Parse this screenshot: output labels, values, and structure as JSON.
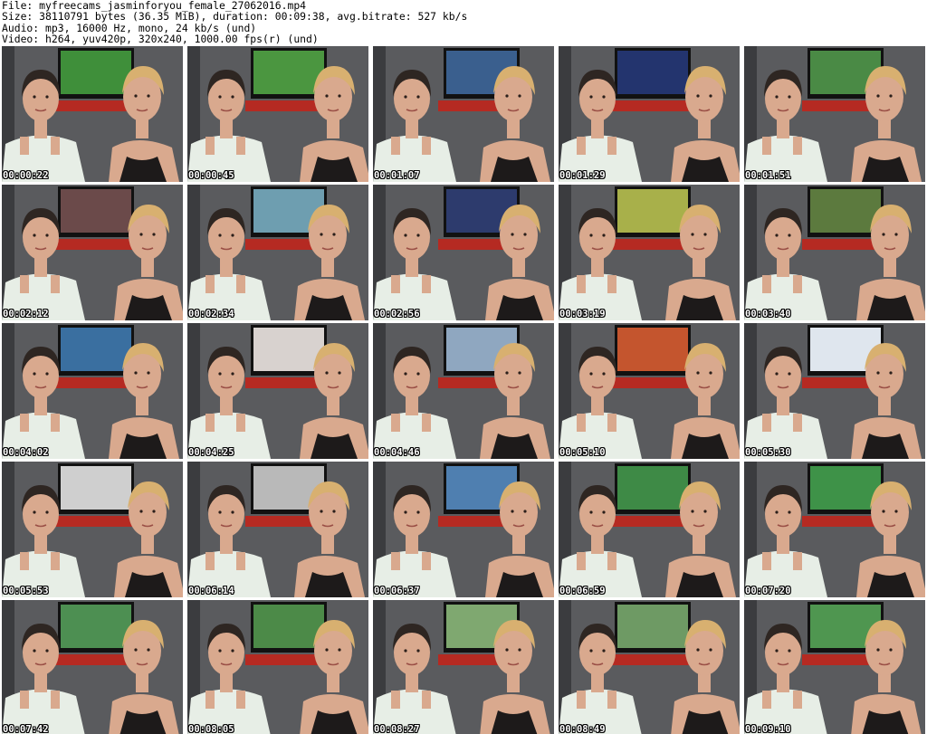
{
  "header": {
    "file_line": "File: myfreecams_jasminforyou_female_27062016.mp4",
    "size_line": "Size: 38110791 bytes (36.35 MiB), duration: 00:09:38, avg.bitrate: 527 kb/s",
    "audio_line": "Audio: mp3, 16000 Hz, mono, 24 kb/s (und)",
    "video_line": "Video: h264, yuv420p, 320x240, 1000.00 fps(r) (und)"
  },
  "colors": {
    "wall": "#5a5b5e",
    "skin": "#d9a98e",
    "blonde": "#d8b070",
    "dark_hair": "#2e2622",
    "white_top": "#e7eee6",
    "black_mesh": "#1d1a1a",
    "tv_frame": "#111111",
    "red_shelf": "#b52a22"
  },
  "thumbnails": [
    {
      "time": "00:00:22",
      "tv": "#3f8f3a"
    },
    {
      "time": "00:00:45",
      "tv": "#4b9640"
    },
    {
      "time": "00:01:07",
      "tv": "#3a5f8e"
    },
    {
      "time": "00:01:29",
      "tv": "#23346e"
    },
    {
      "time": "00:01:51",
      "tv": "#4a8a45"
    },
    {
      "time": "00:02:12",
      "tv": "#6b4a4a"
    },
    {
      "time": "00:02:34",
      "tv": "#6e9eb0"
    },
    {
      "time": "00:02:56",
      "tv": "#2d3b6d"
    },
    {
      "time": "00:03:19",
      "tv": "#a8b04a"
    },
    {
      "time": "00:03:40",
      "tv": "#5c7a3e"
    },
    {
      "time": "00:04:02",
      "tv": "#3a6fa0"
    },
    {
      "time": "00:04:25",
      "tv": "#d8d2cf"
    },
    {
      "time": "00:04:46",
      "tv": "#8fa7c0"
    },
    {
      "time": "00:05:10",
      "tv": "#c4552e"
    },
    {
      "time": "00:05:30",
      "tv": "#dfe6ee"
    },
    {
      "time": "00:05:53",
      "tv": "#cfcfcf"
    },
    {
      "time": "00:06:14",
      "tv": "#b9b9b9"
    },
    {
      "time": "00:06:37",
      "tv": "#4f7fb0"
    },
    {
      "time": "00:06:59",
      "tv": "#3e8a46"
    },
    {
      "time": "00:07:20",
      "tv": "#3e9248"
    },
    {
      "time": "00:07:42",
      "tv": "#4d8f52"
    },
    {
      "time": "00:08:05",
      "tv": "#4c8a48"
    },
    {
      "time": "00:08:27",
      "tv": "#7fa870"
    },
    {
      "time": "00:08:49",
      "tv": "#6e9a64"
    },
    {
      "time": "00:09:10",
      "tv": "#4f9650"
    }
  ]
}
